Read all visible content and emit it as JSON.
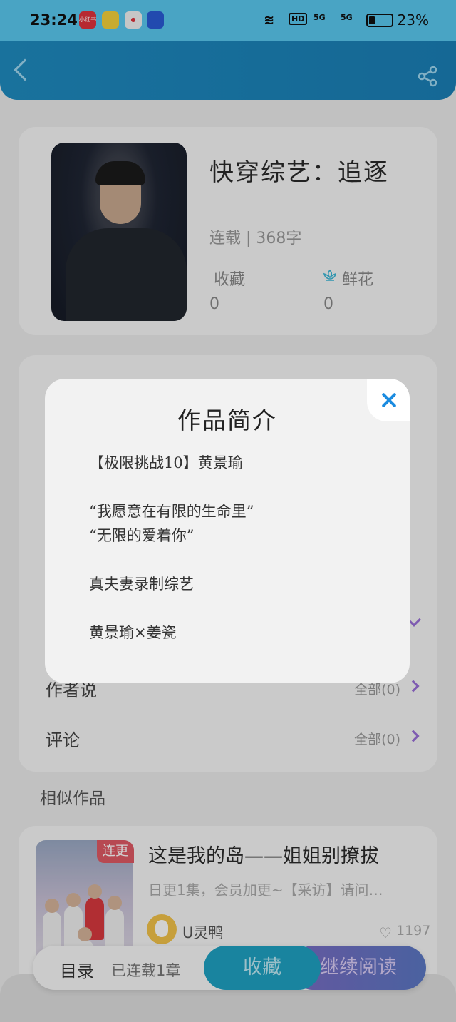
{
  "status_bar": {
    "time": "23:24",
    "apps": [
      "小红书",
      "",
      "",
      ""
    ],
    "signal_1": "5G",
    "signal_2": "5G",
    "hd": "HD",
    "battery_percent": "23%"
  },
  "header": {
    "back_icon": "back-arrow-icon",
    "share_icon": "share-icon"
  },
  "book": {
    "title": "快穿综艺：追逐",
    "status_line": "连载 | 368字",
    "collect_label": "收藏",
    "collect_count": "0",
    "flower_label": "鲜花",
    "flower_count": "0"
  },
  "details": {
    "author_say_label": "作者说",
    "author_say_right": "全部(0)",
    "comments_label": "评论",
    "comments_right": "全部(0)"
  },
  "similar": {
    "heading": "相似作品",
    "badge": "连更",
    "title": "这是我的岛——姐姐别撩拔",
    "desc": "日更1集，会员加更~【采访】请问…",
    "author": "U灵鸭",
    "likes": "1197"
  },
  "bottom_bar": {
    "toc_label": "目录",
    "chapters": "已连载1章",
    "collect_button": "收藏",
    "read_button": "继续阅读"
  },
  "modal": {
    "title": "作品简介",
    "lines": [
      "【极限挑战10】黄景瑜",
      "“我愿意在有限的生命里”",
      "“无限的爱着你”",
      "真夫妻录制综艺",
      "黄景瑜×姜瓷"
    ]
  },
  "colors": {
    "status_bar": "#59c8f0",
    "header": "#1f8bc0",
    "accent_purple": "#9a6fd8",
    "collect_button": "#1fa2c2",
    "read_button": "#7a6cc4",
    "close_icon": "#1a8be0"
  }
}
